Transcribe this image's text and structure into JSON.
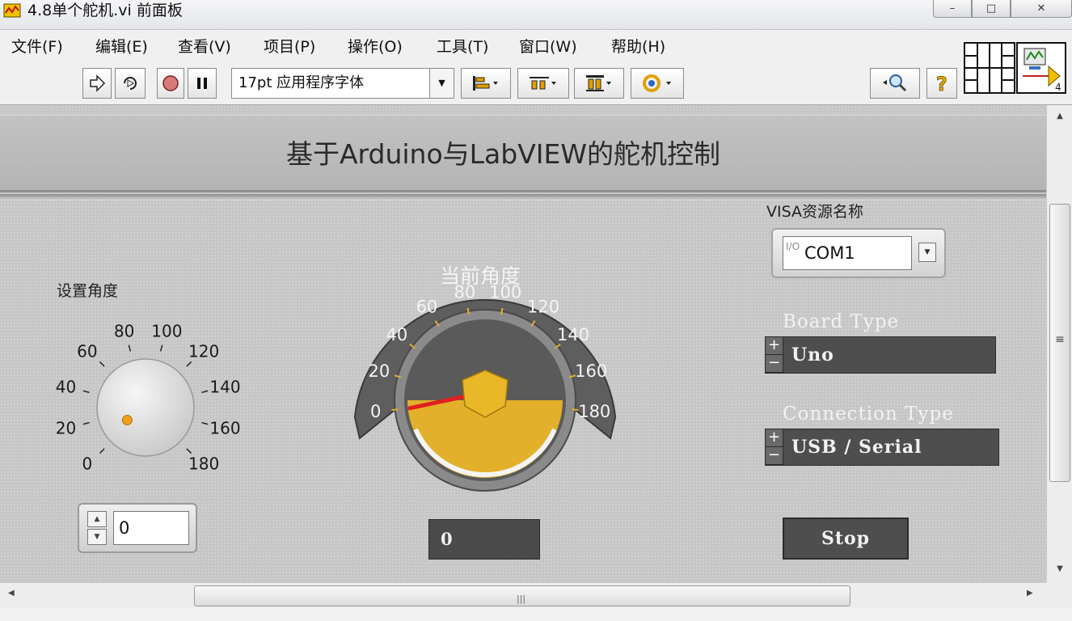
{
  "window": {
    "title": "4.8单个舵机.vi 前面板",
    "minimize_glyph": "–",
    "maximize_glyph": "□",
    "close_glyph": "✕"
  },
  "menu": [
    "文件(F)",
    "编辑(E)",
    "查看(V)",
    "项目(P)",
    "操作(O)",
    "工具(T)",
    "窗口(W)",
    "帮助(H)"
  ],
  "toolbar": {
    "font_select": "17pt 应用程序字体",
    "icon_pane_label": "4",
    "icons": [
      "run-arrow-icon",
      "run-continuously-icon",
      "abort-icon",
      "pause-icon",
      "align-objects-icon",
      "distribute-objects-icon",
      "resize-objects-icon",
      "reorder-icon",
      "search-icon",
      "help-icon",
      "connector-pane-icon",
      "vi-icon"
    ]
  },
  "panel": {
    "header_title": "基于Arduino与LabVIEW的舵机控制",
    "knob": {
      "label": "设置角度",
      "ticks": [
        "0",
        "20",
        "40",
        "60",
        "80",
        "100",
        "120",
        "140",
        "160",
        "180"
      ],
      "value": "0",
      "range": [
        0,
        180
      ],
      "level": 0
    },
    "gauge": {
      "label": "当前角度",
      "ticks": [
        "0",
        "20",
        "40",
        "60",
        "80",
        "100",
        "120",
        "140",
        "160",
        "180"
      ],
      "value": "0",
      "range": [
        0,
        180
      ],
      "level": 0
    },
    "visa": {
      "label": "VISA资源名称",
      "value": "COM1",
      "io_glyph": "I/O"
    },
    "board_type": {
      "label": "Board Type",
      "value": "Uno"
    },
    "connection_type": {
      "label": "Connection Type",
      "value": "USB / Serial"
    },
    "stop_button": "Stop"
  },
  "scrollbars": {
    "grip": "|||",
    "vgrip": "≡"
  },
  "colors": {
    "panel_bg": "#c6c6c6",
    "gauge_face": "#555555",
    "gauge_gold": "#e2b02a",
    "needle": "#e02020",
    "knob_dot": "#f0a020"
  }
}
